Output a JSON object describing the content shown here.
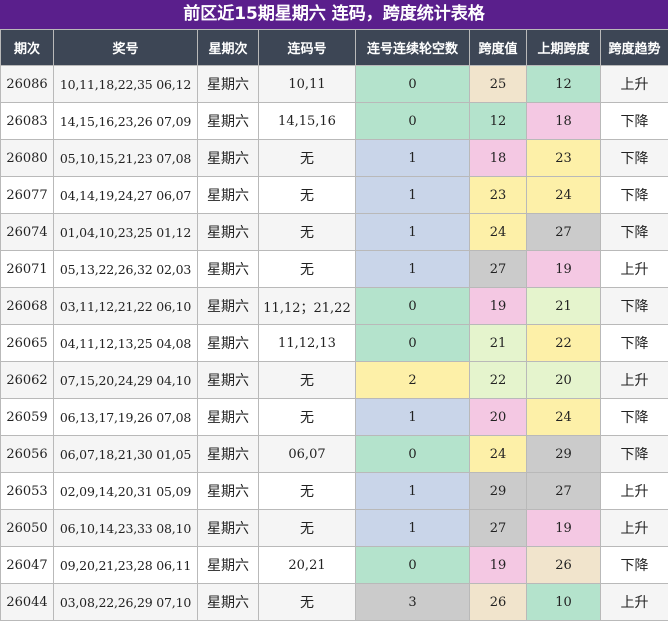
{
  "title": "前区近15期星期六 连码，跨度统计表格",
  "headers": [
    "期次",
    "奖号",
    "星期次",
    "连码号",
    "连号连续轮空数",
    "跨度值",
    "上期跨度",
    "跨度趋势"
  ],
  "colors": {
    "title_bg": "#5a1f8c",
    "header_bg": "#3d4655",
    "green": "#b4e3cc",
    "blue": "#c9d5e9",
    "yellow": "#fdf0a8",
    "gray": "#cbcbcb",
    "pink": "#f4c8e3",
    "tan": "#f1e4cc",
    "lime": "#e5f4cd"
  },
  "rows": [
    {
      "issue": "26086",
      "numbers": "10,11,18,22,35 06,12",
      "weekday": "星期六",
      "consecutive": "10,11",
      "gap": "0",
      "span": "25",
      "prev_span": "12",
      "trend": "上升",
      "gap_color": "green",
      "span_color": "tan",
      "prev_color": "green"
    },
    {
      "issue": "26083",
      "numbers": "14,15,16,23,26 07,09",
      "weekday": "星期六",
      "consecutive": "14,15,16",
      "gap": "0",
      "span": "12",
      "prev_span": "18",
      "trend": "下降",
      "gap_color": "green",
      "span_color": "green",
      "prev_color": "pink"
    },
    {
      "issue": "26080",
      "numbers": "05,10,15,21,23 07,08",
      "weekday": "星期六",
      "consecutive": "无",
      "gap": "1",
      "span": "18",
      "prev_span": "23",
      "trend": "下降",
      "gap_color": "blue",
      "span_color": "pink",
      "prev_color": "yellow"
    },
    {
      "issue": "26077",
      "numbers": "04,14,19,24,27 06,07",
      "weekday": "星期六",
      "consecutive": "无",
      "gap": "1",
      "span": "23",
      "prev_span": "24",
      "trend": "下降",
      "gap_color": "blue",
      "span_color": "yellow",
      "prev_color": "yellow"
    },
    {
      "issue": "26074",
      "numbers": "01,04,10,23,25 01,12",
      "weekday": "星期六",
      "consecutive": "无",
      "gap": "1",
      "span": "24",
      "prev_span": "27",
      "trend": "下降",
      "gap_color": "blue",
      "span_color": "yellow",
      "prev_color": "gray"
    },
    {
      "issue": "26071",
      "numbers": "05,13,22,26,32 02,03",
      "weekday": "星期六",
      "consecutive": "无",
      "gap": "1",
      "span": "27",
      "prev_span": "19",
      "trend": "上升",
      "gap_color": "blue",
      "span_color": "gray",
      "prev_color": "pink"
    },
    {
      "issue": "26068",
      "numbers": "03,11,12,21,22 06,10",
      "weekday": "星期六",
      "consecutive": "11,12；21,22",
      "gap": "0",
      "span": "19",
      "prev_span": "21",
      "trend": "下降",
      "gap_color": "green",
      "span_color": "pink",
      "prev_color": "lime"
    },
    {
      "issue": "26065",
      "numbers": "04,11,12,13,25 04,08",
      "weekday": "星期六",
      "consecutive": "11,12,13",
      "gap": "0",
      "span": "21",
      "prev_span": "22",
      "trend": "下降",
      "gap_color": "green",
      "span_color": "lime",
      "prev_color": "yellow"
    },
    {
      "issue": "26062",
      "numbers": "07,15,20,24,29 04,10",
      "weekday": "星期六",
      "consecutive": "无",
      "gap": "2",
      "span": "22",
      "prev_span": "20",
      "trend": "上升",
      "gap_color": "yellow",
      "span_color": "lime",
      "prev_color": "lime"
    },
    {
      "issue": "26059",
      "numbers": "06,13,17,19,26 07,08",
      "weekday": "星期六",
      "consecutive": "无",
      "gap": "1",
      "span": "20",
      "prev_span": "24",
      "trend": "下降",
      "gap_color": "blue",
      "span_color": "pink",
      "prev_color": "yellow"
    },
    {
      "issue": "26056",
      "numbers": "06,07,18,21,30 01,05",
      "weekday": "星期六",
      "consecutive": "06,07",
      "gap": "0",
      "span": "24",
      "prev_span": "29",
      "trend": "下降",
      "gap_color": "green",
      "span_color": "yellow",
      "prev_color": "gray"
    },
    {
      "issue": "26053",
      "numbers": "02,09,14,20,31 05,09",
      "weekday": "星期六",
      "consecutive": "无",
      "gap": "1",
      "span": "29",
      "prev_span": "27",
      "trend": "上升",
      "gap_color": "blue",
      "span_color": "gray",
      "prev_color": "gray"
    },
    {
      "issue": "26050",
      "numbers": "06,10,14,23,33 08,10",
      "weekday": "星期六",
      "consecutive": "无",
      "gap": "1",
      "span": "27",
      "prev_span": "19",
      "trend": "上升",
      "gap_color": "blue",
      "span_color": "gray",
      "prev_color": "pink"
    },
    {
      "issue": "26047",
      "numbers": "09,20,21,23,28 06,11",
      "weekday": "星期六",
      "consecutive": "20,21",
      "gap": "0",
      "span": "19",
      "prev_span": "26",
      "trend": "下降",
      "gap_color": "green",
      "span_color": "pink",
      "prev_color": "tan"
    },
    {
      "issue": "26044",
      "numbers": "03,08,22,26,29 07,10",
      "weekday": "星期六",
      "consecutive": "无",
      "gap": "3",
      "span": "26",
      "prev_span": "10",
      "trend": "上升",
      "gap_color": "gray",
      "span_color": "tan",
      "prev_color": "green"
    }
  ]
}
